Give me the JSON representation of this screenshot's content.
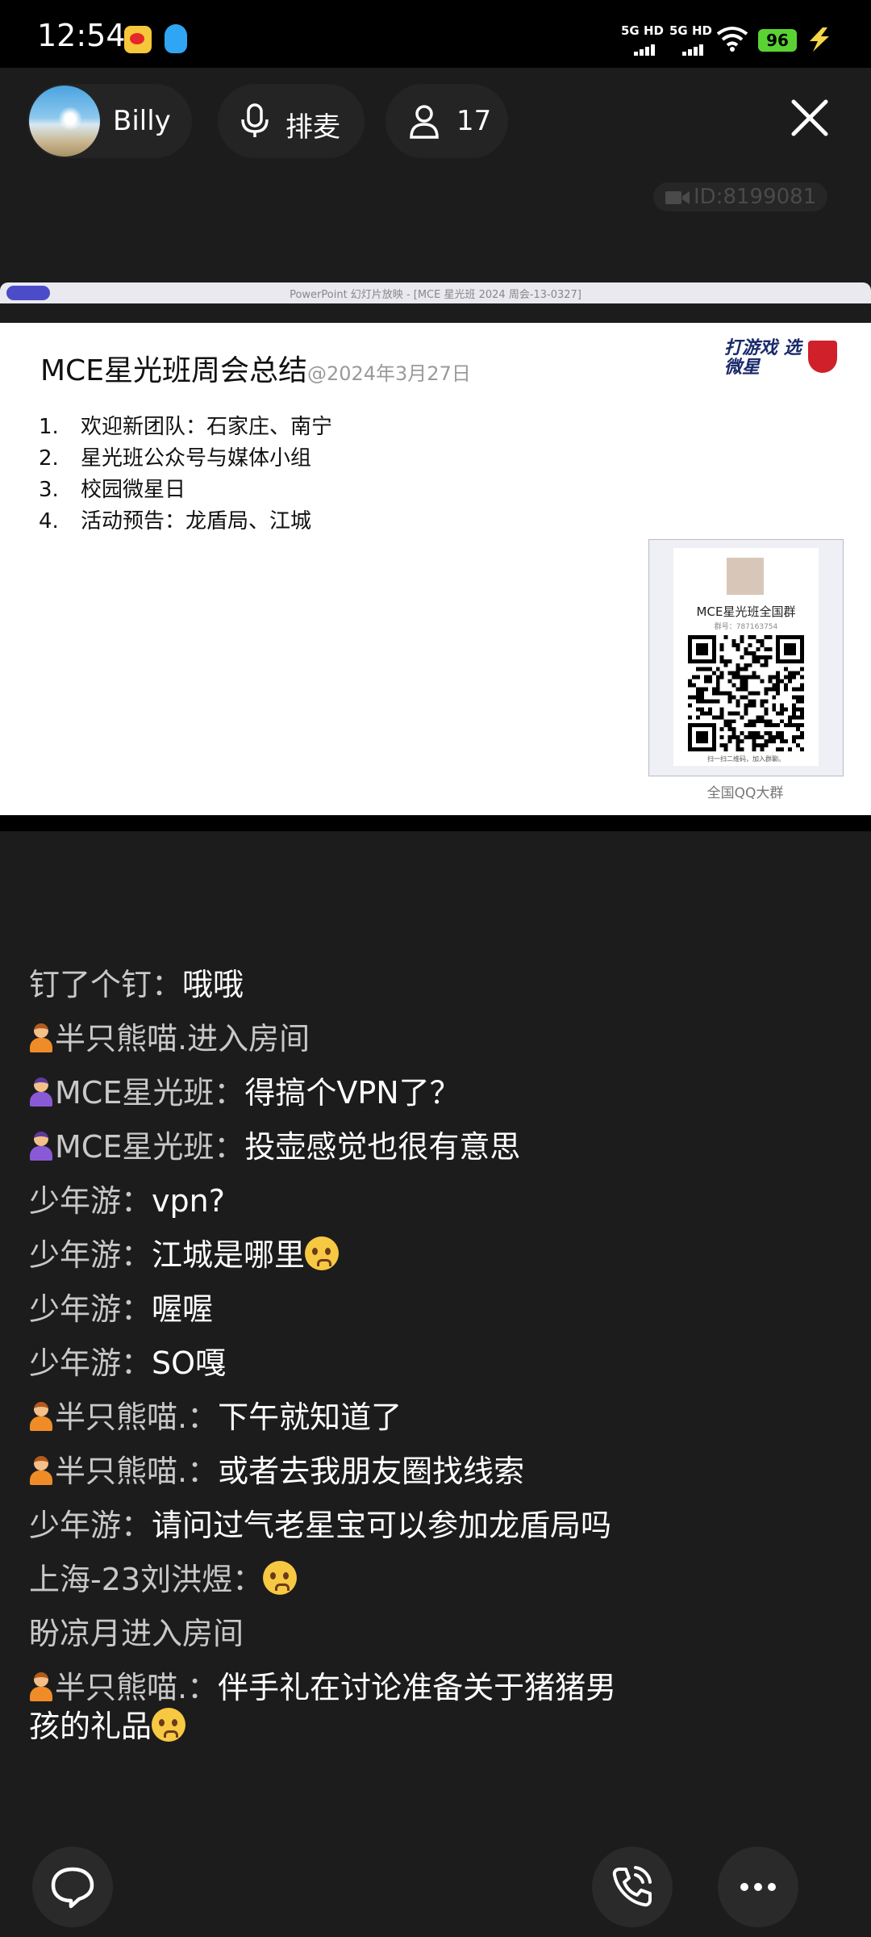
{
  "status_bar": {
    "time": "12:54",
    "network_1": "5G HD",
    "network_2": "5G HD",
    "battery": "96",
    "icons": [
      "weibo-icon",
      "qq-icon",
      "signal-icon",
      "wifi-icon",
      "battery-icon",
      "charging-icon"
    ]
  },
  "room": {
    "host_name": "Billy",
    "mic_label": "排麦",
    "audience_count": "17",
    "room_id": "ID:8199081"
  },
  "screen_share": {
    "window_title": "PowerPoint 幻灯片放映 - [MCE 星光班 2024 周会-13-0327]",
    "slide_title": "MCE星光班周会总结",
    "slide_date": "@2024年3月27日",
    "agenda": [
      {
        "num": "1.",
        "text": "欢迎新团队：石家庄、南宁"
      },
      {
        "num": "2.",
        "text": "星光班公众号与媒体小组"
      },
      {
        "num": "3.",
        "text": "校园微星日"
      },
      {
        "num": "4.",
        "text": "活动预告：龙盾局、江城"
      }
    ],
    "brand_text": "打游戏 选微星",
    "qr_group_name": "MCE星光班全国群",
    "qr_group_number": "群号：787163754",
    "qr_hint": "扫一扫二维码，加入群聊。",
    "qr_caption": "全国QQ大群"
  },
  "chat": [
    {
      "who": "钉了个钉：",
      "text": "哦哦",
      "badge": ""
    },
    {
      "who": "",
      "text": "半只熊喵.进入房间",
      "badge": "orange",
      "system": true
    },
    {
      "who": "MCE星光班：",
      "text": "得搞个VPN了？",
      "badge": "purple"
    },
    {
      "who": "MCE星光班：",
      "text": "投壶感觉也很有意思",
      "badge": "purple"
    },
    {
      "who": "少年游：",
      "text": "vpn?",
      "badge": ""
    },
    {
      "who": "少年游：",
      "text": "江城是哪里",
      "badge": "",
      "emoji": "pleading-face"
    },
    {
      "who": "少年游：",
      "text": "喔喔",
      "badge": ""
    },
    {
      "who": "少年游：",
      "text": "SO嘎",
      "badge": ""
    },
    {
      "who": "半只熊喵.：",
      "text": "下午就知道了",
      "badge": "orange"
    },
    {
      "who": "半只熊喵.：",
      "text": "或者去我朋友圈找线索",
      "badge": "orange"
    },
    {
      "who": "少年游：",
      "text": "请问过气老星宝可以参加龙盾局吗",
      "badge": ""
    },
    {
      "who": "上海-23刘洪煜：",
      "text": "",
      "badge": "",
      "emoji": "thinking-face"
    },
    {
      "who": "",
      "text": "盼凉月进入房间",
      "badge": "",
      "system": true
    },
    {
      "who": "半只熊喵.：",
      "text": "伴手礼在讨论准备关于猪猪男孩的礼品",
      "badge": "orange",
      "emoji": "thinking-face"
    }
  ],
  "actions": {
    "chat": "chat-bubble-icon",
    "call": "phone-icon",
    "more": "more-icon"
  }
}
